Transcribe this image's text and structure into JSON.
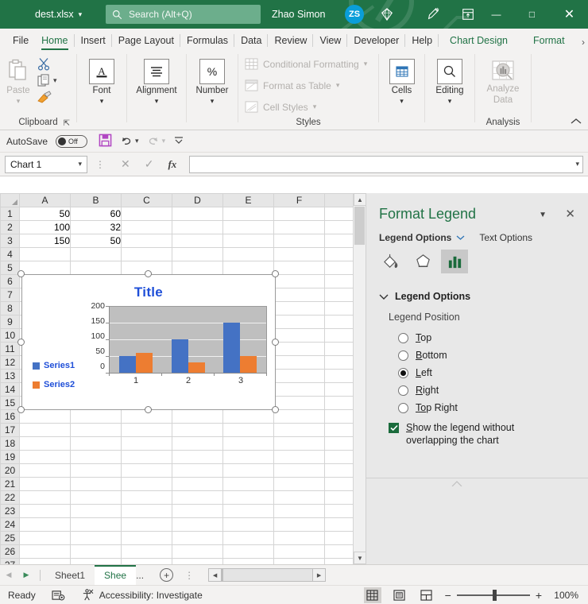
{
  "titlebar": {
    "filename": "dest.xlsx",
    "filename_chevron": "chevron-down",
    "search_placeholder": "Search (Alt+Q)",
    "user_name": "Zhao Simon",
    "avatar_initials": "ZS",
    "icons": [
      "diamond-icon",
      "pen-ink-icon",
      "ribbon-display-options-icon"
    ],
    "minimize": "—",
    "maximize": "□",
    "close": "✕",
    "bg_color": "#217346",
    "search_bg_color": "#6cae8c"
  },
  "ribbon_tabs": {
    "items": [
      {
        "label": "File",
        "state": "normal"
      },
      {
        "label": "Home",
        "state": "active"
      },
      {
        "label": "Insert",
        "state": "normal"
      },
      {
        "label": "Page Layout",
        "state": "normal"
      },
      {
        "label": "Formulas",
        "state": "normal"
      },
      {
        "label": "Data",
        "state": "normal"
      },
      {
        "label": "Review",
        "state": "normal"
      },
      {
        "label": "View",
        "state": "normal"
      },
      {
        "label": "Developer",
        "state": "normal"
      },
      {
        "label": "Help",
        "state": "normal"
      },
      {
        "label": "Chart Design",
        "state": "contextual"
      },
      {
        "label": "Format",
        "state": "contextual"
      }
    ],
    "overflow": "›"
  },
  "ribbon": {
    "clipboard": {
      "group_name": "Clipboard",
      "paste_label": "Paste",
      "paste_icon": "paste-icon",
      "cut_icon": "scissors-icon",
      "copy_icon": "copy-icon",
      "format_painter_icon": "format-painter-icon",
      "dialog_launcher_icon": "dialog-launcher-icon"
    },
    "font": {
      "label": "Font",
      "icon": "font-icon"
    },
    "alignment": {
      "label": "Alignment",
      "icon": "alignment-icon"
    },
    "number": {
      "label": "Number",
      "icon": "percent-icon"
    },
    "styles": {
      "group_name": "Styles",
      "items": [
        {
          "label": "Conditional Formatting",
          "icon": "conditional-formatting-icon"
        },
        {
          "label": "Format as Table",
          "icon": "format-as-table-icon"
        },
        {
          "label": "Cell Styles",
          "icon": "cell-styles-icon"
        }
      ]
    },
    "cells": {
      "label": "Cells",
      "icon": "cells-icon"
    },
    "editing": {
      "label": "Editing",
      "icon": "editing-search-icon"
    },
    "analysis": {
      "group_name": "Analysis",
      "label_line1": "Analyze",
      "label_line2": "Data",
      "icon": "analyze-data-icon"
    },
    "collapse_icon": "chevron-up-icon"
  },
  "quick_access": {
    "autosave_label": "AutoSave",
    "autosave_state": "Off",
    "save_icon": "save-icon",
    "undo_icon": "undo-icon",
    "redo_icon": "redo-icon",
    "customize_icon": "customize-qat-icon"
  },
  "formula_bar": {
    "name_box_value": "Chart 1",
    "name_box_chevron": "chevron-down-icon",
    "cancel_icon": "cancel-icon",
    "enter_icon": "enter-icon",
    "function_icon": "insert-function-icon",
    "formula_value": "",
    "expand_icon": "expand-formula-bar-icon"
  },
  "grid": {
    "columns": [
      "A",
      "B",
      "C",
      "D",
      "E",
      "F",
      ""
    ],
    "rows": [
      {
        "num": "1",
        "cells": [
          "50",
          "60",
          "",
          "",
          "",
          "",
          ""
        ]
      },
      {
        "num": "2",
        "cells": [
          "100",
          "32",
          "",
          "",
          "",
          "",
          ""
        ]
      },
      {
        "num": "3",
        "cells": [
          "150",
          "50",
          "",
          "",
          "",
          "",
          ""
        ]
      },
      {
        "num": "4",
        "cells": [
          "",
          "",
          "",
          "",
          "",
          "",
          ""
        ]
      },
      {
        "num": "5",
        "cells": [
          "",
          "",
          "",
          "",
          "",
          "",
          ""
        ]
      },
      {
        "num": "6",
        "cells": [
          "",
          "",
          "",
          "",
          "",
          "",
          ""
        ]
      },
      {
        "num": "7",
        "cells": [
          "",
          "",
          "",
          "",
          "",
          "",
          ""
        ]
      },
      {
        "num": "8",
        "cells": [
          "",
          "",
          "",
          "",
          "",
          "",
          ""
        ]
      },
      {
        "num": "9",
        "cells": [
          "",
          "",
          "",
          "",
          "",
          "",
          ""
        ]
      },
      {
        "num": "10",
        "cells": [
          "",
          "",
          "",
          "",
          "",
          "",
          ""
        ]
      },
      {
        "num": "11",
        "cells": [
          "",
          "",
          "",
          "",
          "",
          "",
          ""
        ]
      },
      {
        "num": "12",
        "cells": [
          "",
          "",
          "",
          "",
          "",
          "",
          ""
        ]
      },
      {
        "num": "13",
        "cells": [
          "",
          "",
          "",
          "",
          "",
          "",
          ""
        ]
      },
      {
        "num": "14",
        "cells": [
          "",
          "",
          "",
          "",
          "",
          "",
          ""
        ]
      },
      {
        "num": "15",
        "cells": [
          "",
          "",
          "",
          "",
          "",
          "",
          ""
        ]
      },
      {
        "num": "16",
        "cells": [
          "",
          "",
          "",
          "",
          "",
          "",
          ""
        ]
      },
      {
        "num": "17",
        "cells": [
          "",
          "",
          "",
          "",
          "",
          "",
          ""
        ]
      },
      {
        "num": "18",
        "cells": [
          "",
          "",
          "",
          "",
          "",
          "",
          ""
        ]
      },
      {
        "num": "19",
        "cells": [
          "",
          "",
          "",
          "",
          "",
          "",
          ""
        ]
      },
      {
        "num": "20",
        "cells": [
          "",
          "",
          "",
          "",
          "",
          "",
          ""
        ]
      },
      {
        "num": "21",
        "cells": [
          "",
          "",
          "",
          "",
          "",
          "",
          ""
        ]
      },
      {
        "num": "22",
        "cells": [
          "",
          "",
          "",
          "",
          "",
          "",
          ""
        ]
      },
      {
        "num": "23",
        "cells": [
          "",
          "",
          "",
          "",
          "",
          "",
          ""
        ]
      },
      {
        "num": "24",
        "cells": [
          "",
          "",
          "",
          "",
          "",
          "",
          ""
        ]
      },
      {
        "num": "25",
        "cells": [
          "",
          "",
          "",
          "",
          "",
          "",
          ""
        ]
      },
      {
        "num": "26",
        "cells": [
          "",
          "",
          "",
          "",
          "",
          "",
          ""
        ]
      },
      {
        "num": "27",
        "cells": [
          "",
          "",
          "",
          "",
          "",
          "",
          ""
        ]
      }
    ]
  },
  "chart_data": {
    "type": "bar",
    "title": "Title",
    "categories": [
      "1",
      "2",
      "3"
    ],
    "series": [
      {
        "name": "Series1",
        "values": [
          50,
          100,
          150
        ],
        "color": "#4472c4"
      },
      {
        "name": "Series2",
        "values": [
          60,
          32,
          50
        ],
        "color": "#ed7d31"
      }
    ],
    "xlabel": "",
    "ylabel": "",
    "ylim": [
      0,
      200
    ],
    "yticks": [
      "200",
      "150",
      "100",
      "50",
      "0"
    ],
    "grid": true,
    "legend_position": "left",
    "plot_area_fill": "#bfbfbf",
    "title_color": "#1f4fd8",
    "legend_text_color": "#1f4fd8",
    "selected": true
  },
  "task_pane": {
    "title": "Format Legend",
    "dropdown_icon": "task-pane-menu-icon",
    "close_icon": "close-icon",
    "tabs": [
      {
        "label": "Legend Options",
        "selected": true,
        "chevron": "chevron-down-icon"
      },
      {
        "label": "Text Options",
        "selected": false
      }
    ],
    "icon_tabs": [
      {
        "name": "fill-and-line-icon",
        "selected": false
      },
      {
        "name": "effects-icon",
        "selected": false
      },
      {
        "name": "legend-options-icon",
        "selected": true
      }
    ],
    "section": {
      "header": "Legend Options",
      "expand_icon": "chevron-down-icon",
      "position_label": "Legend Position",
      "options": [
        {
          "accel": "T",
          "rest": "op",
          "selected": false
        },
        {
          "accel": "B",
          "rest": "ottom",
          "selected": false
        },
        {
          "accel": "L",
          "rest": "eft",
          "selected": true
        },
        {
          "accel": "R",
          "rest": "ight",
          "selected": false
        },
        {
          "accel": "To",
          "rest": "p Right",
          "selected": false
        }
      ],
      "checkbox": {
        "accel": "S",
        "line1_rest": "how the legend without",
        "line2": "overlapping the chart",
        "checked": true
      }
    }
  },
  "sheet_bar": {
    "first_arrow": "◀",
    "next_arrow": "▶",
    "tabs": [
      {
        "label": "Sheet1",
        "active": false
      },
      {
        "label": "Shee",
        "active": true
      },
      {
        "label": "...",
        "active": false
      }
    ],
    "add_sheet_icon": "add-sheet-icon",
    "scroll_left": "◀",
    "scroll_right": "▶"
  },
  "status_bar": {
    "state": "Ready",
    "macro_icon": "record-macro-icon",
    "accessibility_icon": "accessibility-icon",
    "accessibility_label": "Accessibility: Investigate",
    "views": [
      {
        "name": "normal-view-icon",
        "selected": true
      },
      {
        "name": "page-layout-view-icon",
        "selected": false
      },
      {
        "name": "page-break-preview-icon",
        "selected": false
      }
    ],
    "zoom_out": "−",
    "zoom_in": "+",
    "zoom_level": "100%"
  }
}
